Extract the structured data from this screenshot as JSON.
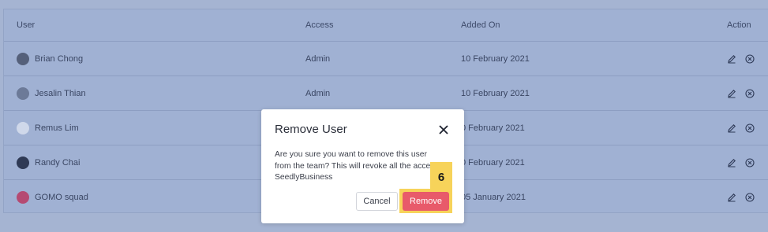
{
  "table": {
    "headers": {
      "user": "User",
      "access": "Access",
      "added_on": "Added On",
      "action": "Action"
    },
    "rows": [
      {
        "name": "Brian Chong",
        "access": "Admin",
        "added_on": "10 February 2021",
        "avatar_color": "#55607a"
      },
      {
        "name": "Jesalin Thian",
        "access": "Admin",
        "added_on": "10 February 2021",
        "avatar_color": "#6c7a98"
      },
      {
        "name": "Remus Lim",
        "access": "",
        "added_on": "0 February 2021",
        "avatar_color": "#cfd8ea"
      },
      {
        "name": "Randy Chai",
        "access": "",
        "added_on": "0 February 2021",
        "avatar_color": "#2f3a55"
      },
      {
        "name": "GOMO squad",
        "access": "",
        "added_on": "05 January 2021",
        "avatar_color": "#b54a72"
      }
    ]
  },
  "modal": {
    "title": "Remove User",
    "body": "Are you sure you want to remove this user from the team? This will revoke all the acce SeedlyBusiness",
    "cancel_label": "Cancel",
    "remove_label": "Remove",
    "remove_color": "#e85a6a"
  },
  "step_badge": "6",
  "colors": {
    "overlay": "#a0b1d3",
    "highlight": "#f7d35a"
  }
}
